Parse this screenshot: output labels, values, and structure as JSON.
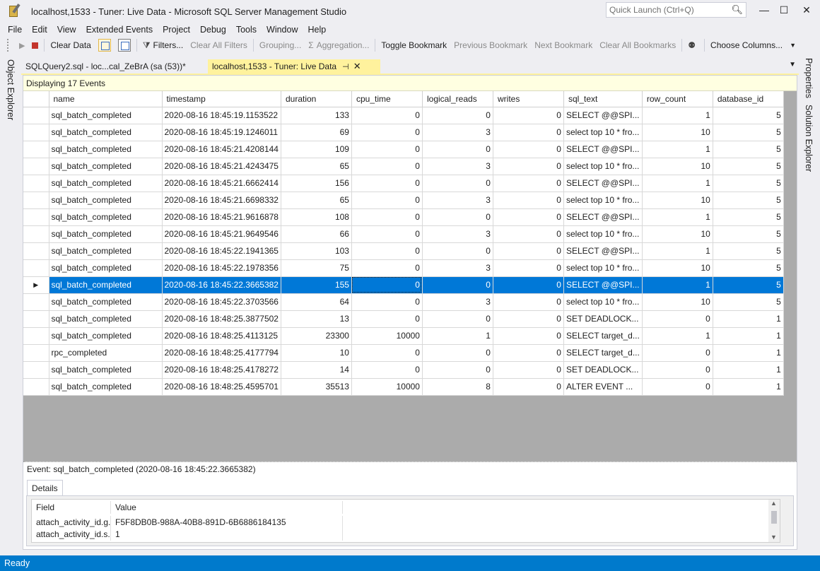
{
  "window": {
    "title": "localhost,1533 - Tuner: Live Data - Microsoft SQL Server Management Studio",
    "quick_launch_placeholder": "Quick Launch (Ctrl+Q)",
    "minimize": "—",
    "maximize": "☐",
    "close": "✕"
  },
  "menu": [
    "File",
    "Edit",
    "View",
    "Extended Events",
    "Project",
    "Debug",
    "Tools",
    "Window",
    "Help"
  ],
  "toolbar": {
    "clear_data": "Clear Data",
    "filters": "Filters...",
    "clear_all_filters": "Clear All Filters",
    "grouping": "Grouping...",
    "aggregation": "Aggregation...",
    "toggle_bookmark": "Toggle Bookmark",
    "previous_bookmark": "Previous Bookmark",
    "next_bookmark": "Next Bookmark",
    "clear_all_bookmarks": "Clear All Bookmarks",
    "choose_columns": "Choose Columns..."
  },
  "side_panels": {
    "left": "Object Explorer",
    "right_top": "Properties",
    "right_bottom": "Solution Explorer"
  },
  "tabs": [
    {
      "label": "SQLQuery2.sql - loc...cal_ZeBrA (sa (53))*",
      "active": false
    },
    {
      "label": "localhost,1533 - Tuner: Live Data",
      "active": true
    }
  ],
  "info_bar": "Displaying 17 Events",
  "grid": {
    "columns": [
      "name",
      "timestamp",
      "duration",
      "cpu_time",
      "logical_reads",
      "writes",
      "sql_text",
      "row_count",
      "database_id"
    ],
    "selected_index": 10,
    "rows": [
      [
        "sql_batch_completed",
        "2020-08-16 18:45:19.1153522",
        "133",
        "0",
        "0",
        "0",
        "SELECT @@SPI...",
        "1",
        "5"
      ],
      [
        "sql_batch_completed",
        "2020-08-16 18:45:19.1246011",
        "69",
        "0",
        "3",
        "0",
        "select top 10 * fro...",
        "10",
        "5"
      ],
      [
        "sql_batch_completed",
        "2020-08-16 18:45:21.4208144",
        "109",
        "0",
        "0",
        "0",
        "SELECT @@SPI...",
        "1",
        "5"
      ],
      [
        "sql_batch_completed",
        "2020-08-16 18:45:21.4243475",
        "65",
        "0",
        "3",
        "0",
        "select top 10 * fro...",
        "10",
        "5"
      ],
      [
        "sql_batch_completed",
        "2020-08-16 18:45:21.6662414",
        "156",
        "0",
        "0",
        "0",
        "SELECT @@SPI...",
        "1",
        "5"
      ],
      [
        "sql_batch_completed",
        "2020-08-16 18:45:21.6698332",
        "65",
        "0",
        "3",
        "0",
        "select top 10 * fro...",
        "10",
        "5"
      ],
      [
        "sql_batch_completed",
        "2020-08-16 18:45:21.9616878",
        "108",
        "0",
        "0",
        "0",
        "SELECT @@SPI...",
        "1",
        "5"
      ],
      [
        "sql_batch_completed",
        "2020-08-16 18:45:21.9649546",
        "66",
        "0",
        "3",
        "0",
        "select top 10 * fro...",
        "10",
        "5"
      ],
      [
        "sql_batch_completed",
        "2020-08-16 18:45:22.1941365",
        "103",
        "0",
        "0",
        "0",
        "SELECT @@SPI...",
        "1",
        "5"
      ],
      [
        "sql_batch_completed",
        "2020-08-16 18:45:22.1978356",
        "75",
        "0",
        "3",
        "0",
        "select top 10 * fro...",
        "10",
        "5"
      ],
      [
        "sql_batch_completed",
        "2020-08-16 18:45:22.3665382",
        "155",
        "0",
        "0",
        "0",
        "SELECT @@SPI...",
        "1",
        "5"
      ],
      [
        "sql_batch_completed",
        "2020-08-16 18:45:22.3703566",
        "64",
        "0",
        "3",
        "0",
        "select top 10 * fro...",
        "10",
        "5"
      ],
      [
        "sql_batch_completed",
        "2020-08-16 18:48:25.3877502",
        "13",
        "0",
        "0",
        "0",
        "SET DEADLOCK...",
        "0",
        "1"
      ],
      [
        "sql_batch_completed",
        "2020-08-16 18:48:25.4113125",
        "23300",
        "10000",
        "1",
        "0",
        "SELECT target_d...",
        "1",
        "1"
      ],
      [
        "rpc_completed",
        "2020-08-16 18:48:25.4177794",
        "10",
        "0",
        "0",
        "0",
        "SELECT target_d...",
        "0",
        "1"
      ],
      [
        "sql_batch_completed",
        "2020-08-16 18:48:25.4178272",
        "14",
        "0",
        "0",
        "0",
        "SET DEADLOCK...",
        "0",
        "1"
      ],
      [
        "sql_batch_completed",
        "2020-08-16 18:48:25.4595701",
        "35513",
        "10000",
        "8",
        "0",
        "ALTER EVENT ...",
        "0",
        "1"
      ]
    ]
  },
  "details": {
    "event_caption": "Event: sql_batch_completed (2020-08-16 18:45:22.3665382)",
    "tab": "Details",
    "header": {
      "field": "Field",
      "value": "Value"
    },
    "rows": [
      {
        "field": "attach_activity_id.g...",
        "value": "F5F8DB0B-988A-40B8-891D-6B6886184135"
      },
      {
        "field": "attach_activity_id.s...",
        "value": "1"
      }
    ]
  },
  "status": "Ready",
  "colors": {
    "accent": "#007acc",
    "selection": "#0078d7",
    "active_tab": "#fff29d",
    "info_bar": "#ffffe1"
  }
}
